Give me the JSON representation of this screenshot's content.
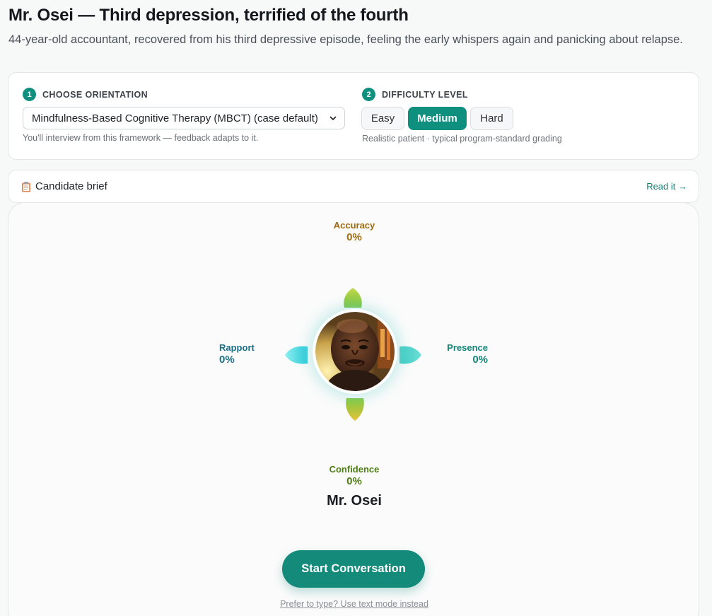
{
  "header": {
    "title": "Mr. Osei — Third depression, terrified of the fourth",
    "subtitle": "44-year-old accountant, recovered from his third depressive episode, feeling the early whispers again and panicking about relapse."
  },
  "setup": {
    "orientation": {
      "step": "1",
      "heading": "CHOOSE ORIENTATION",
      "selected": "Mindfulness-Based Cognitive Therapy (MBCT) (case default)",
      "hint": "You'll interview from this framework — feedback adapts to it."
    },
    "difficulty": {
      "step": "2",
      "heading": "DIFFICULTY LEVEL",
      "options": [
        "Easy",
        "Medium",
        "Hard"
      ],
      "selected": "Medium",
      "hint": "Realistic patient · typical program-standard grading"
    }
  },
  "brief": {
    "icon": "clipboard-icon",
    "title": "Candidate brief",
    "link": "Read it →"
  },
  "stage": {
    "metrics": {
      "accuracy": {
        "label": "Accuracy",
        "value": "0%",
        "color": "#a26a0c"
      },
      "rapport": {
        "label": "Rapport",
        "value": "0%",
        "color": "#1b6f88"
      },
      "presence": {
        "label": "Presence",
        "value": "0%",
        "color": "#128578"
      },
      "confidence": {
        "label": "Confidence",
        "value": "0%",
        "color": "#4d7d12"
      }
    },
    "persona_name": "Mr. Osei",
    "start_button": "Start Conversation",
    "text_mode_link": "Prefer to type? Use text mode instead"
  },
  "colors": {
    "accent": "#0f8f7e",
    "leaf_top": "#8fcb3a",
    "leaf_side": "#3fd6e0",
    "leaf_bottom": "#b4d63a"
  }
}
